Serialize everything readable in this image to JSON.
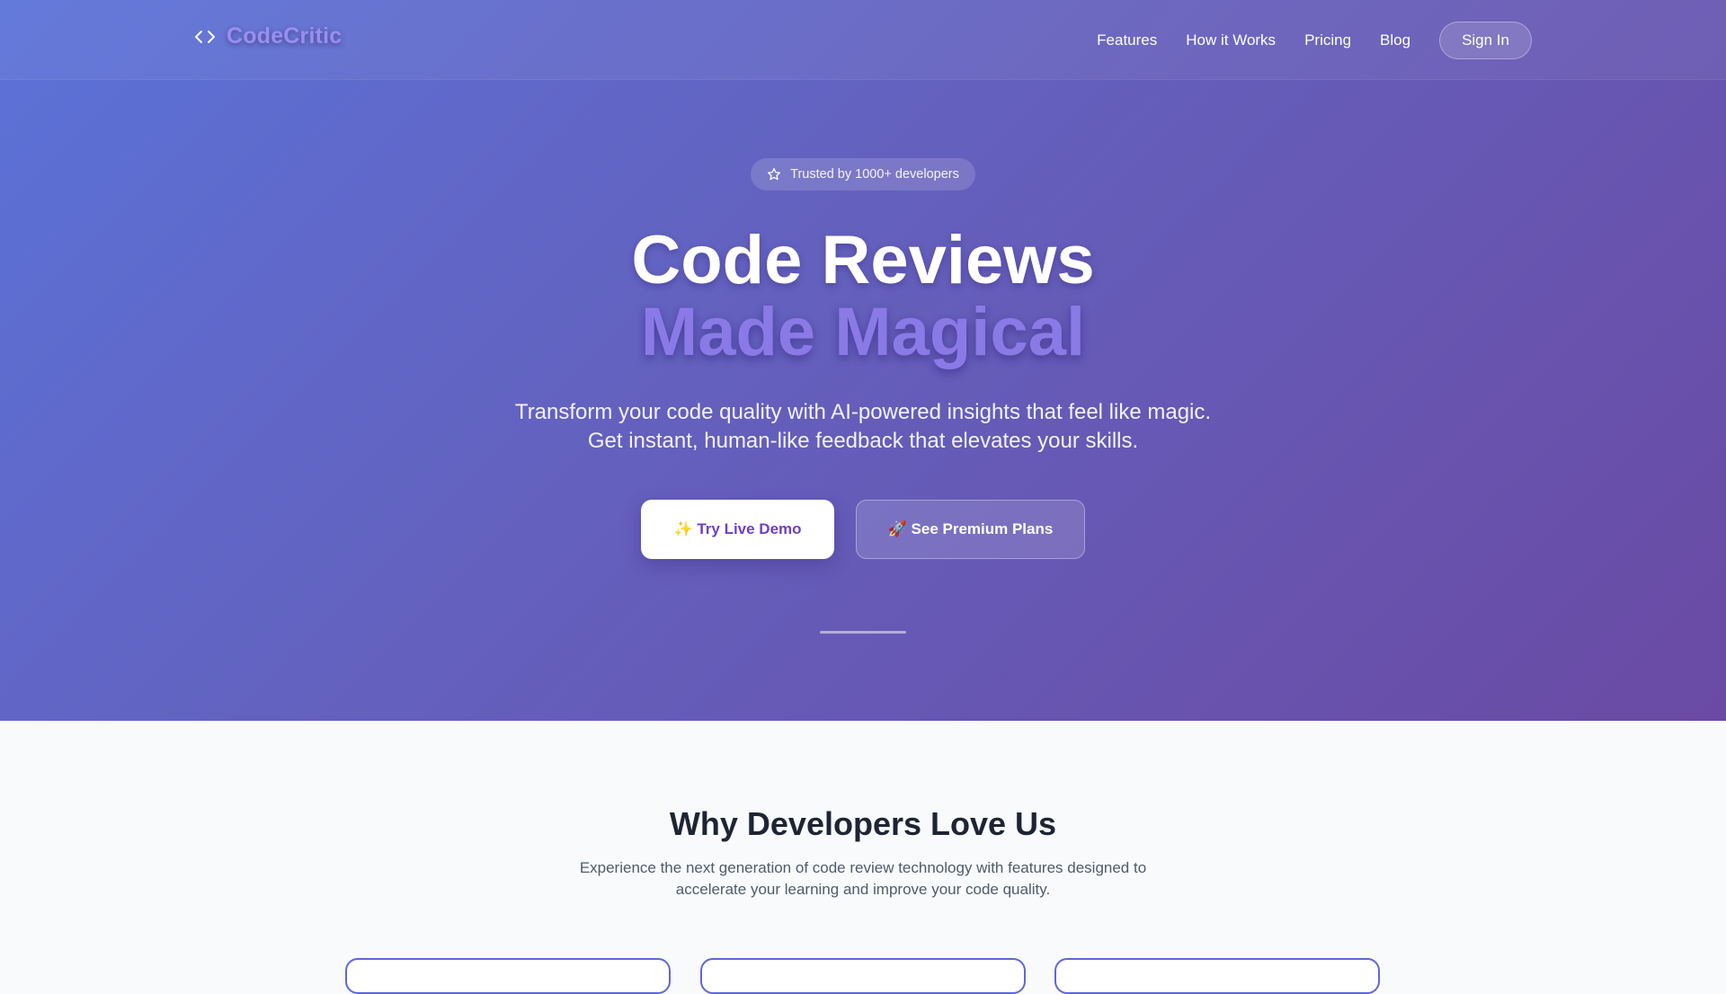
{
  "brand": {
    "name": "CodeCritic",
    "icon": "code-brackets-icon"
  },
  "nav": {
    "links": [
      "Features",
      "How it Works",
      "Pricing",
      "Blog"
    ],
    "sign_in": "Sign In"
  },
  "hero": {
    "badge": {
      "icon": "star-icon",
      "text": "Trusted by 1000+ developers"
    },
    "headline_line1": "Code Reviews",
    "headline_line2": "Made Magical",
    "subtitle": "Transform your code quality with AI-powered insights that feel like magic. Get instant, human-like feedback that elevates your skills.",
    "cta_primary": "✨ Try Live Demo",
    "cta_secondary": "🚀 See Premium Plans"
  },
  "features_section": {
    "title": "Why Developers Love Us",
    "description": "Experience the next generation of code review technology with features designed to accelerate your learning and improve your code quality."
  },
  "colors": {
    "hero_gradient_start": "#5b72d8",
    "hero_gradient_end": "#6a4aa4",
    "accent_purple": "#8a7ae6",
    "demo_button_text": "#6d3fc4",
    "card_border": "#5f67d6"
  }
}
